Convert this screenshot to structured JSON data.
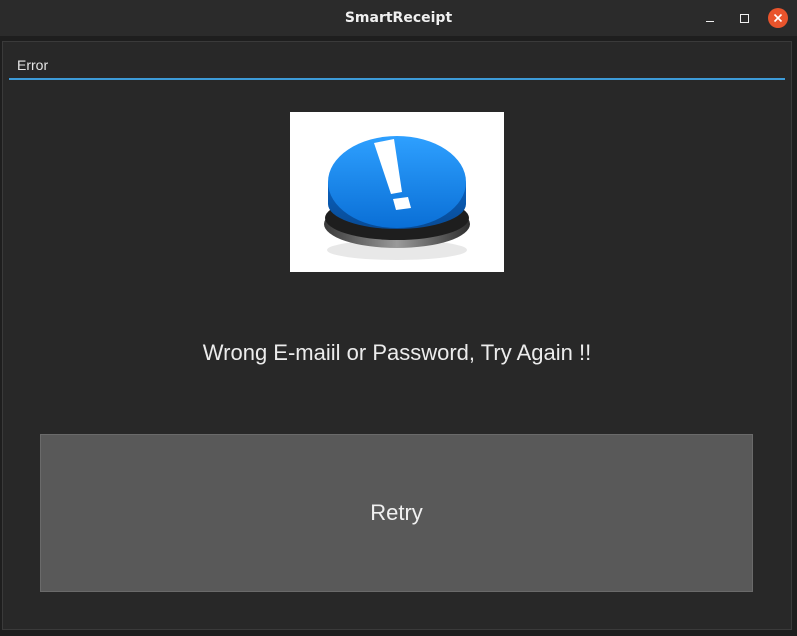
{
  "window": {
    "title": "SmartReceipt",
    "controls": {
      "minimize_icon": "minimize-icon",
      "maximize_icon": "maximize-icon",
      "close_icon": "close-icon"
    }
  },
  "dialog": {
    "tab_label": "Error",
    "image_icon": "exclamation-button-icon",
    "message": "Wrong E-maiil or Password, Try Again !!",
    "retry_label": "Retry"
  },
  "colors": {
    "accent": "#3d9bd8",
    "close_button": "#e9542c",
    "background": "#282828",
    "button": "#595959",
    "icon_blue": "#1f8ff0"
  }
}
